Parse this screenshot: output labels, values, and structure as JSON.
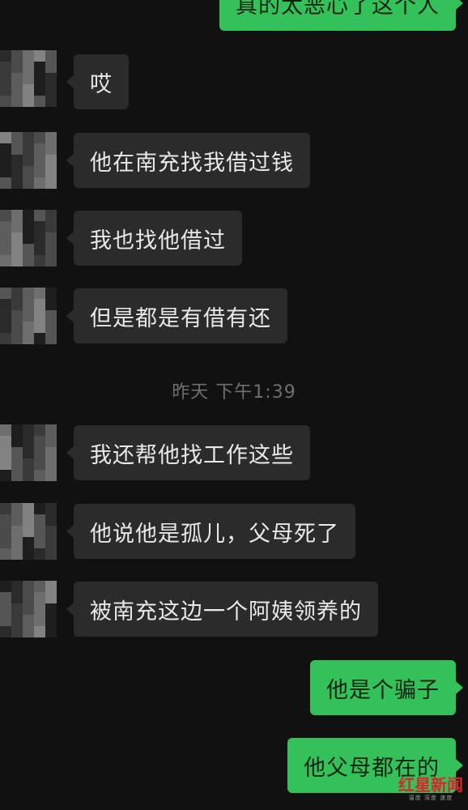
{
  "messages": [
    {
      "side": "out",
      "text": "真的太恶心了这个人"
    },
    {
      "side": "in",
      "text": "哎"
    },
    {
      "side": "in",
      "text": "他在南充找我借过钱"
    },
    {
      "side": "in",
      "text": "我也找他借过"
    },
    {
      "side": "in",
      "text": "但是都是有借有还"
    },
    {
      "side": "in",
      "text": "我还帮他找工作这些"
    },
    {
      "side": "in",
      "text": "他说他是孤儿，父母死了"
    },
    {
      "side": "in",
      "text": "被南充这边一个阿姨领养的"
    },
    {
      "side": "out",
      "text": "他是个骗子"
    },
    {
      "side": "out",
      "text": "他父母都在的"
    }
  ],
  "timestamp": "昨天 下午1:39",
  "watermark": {
    "main": "红星新闻",
    "sub": "温度 深度 速度"
  },
  "colors": {
    "background": "#111111",
    "incoming_bubble": "#2b2b2b",
    "outgoing_bubble": "#35c15a",
    "timestamp": "#6f6f6f",
    "watermark": "#d8262c"
  },
  "avatar_state": "pixelated"
}
